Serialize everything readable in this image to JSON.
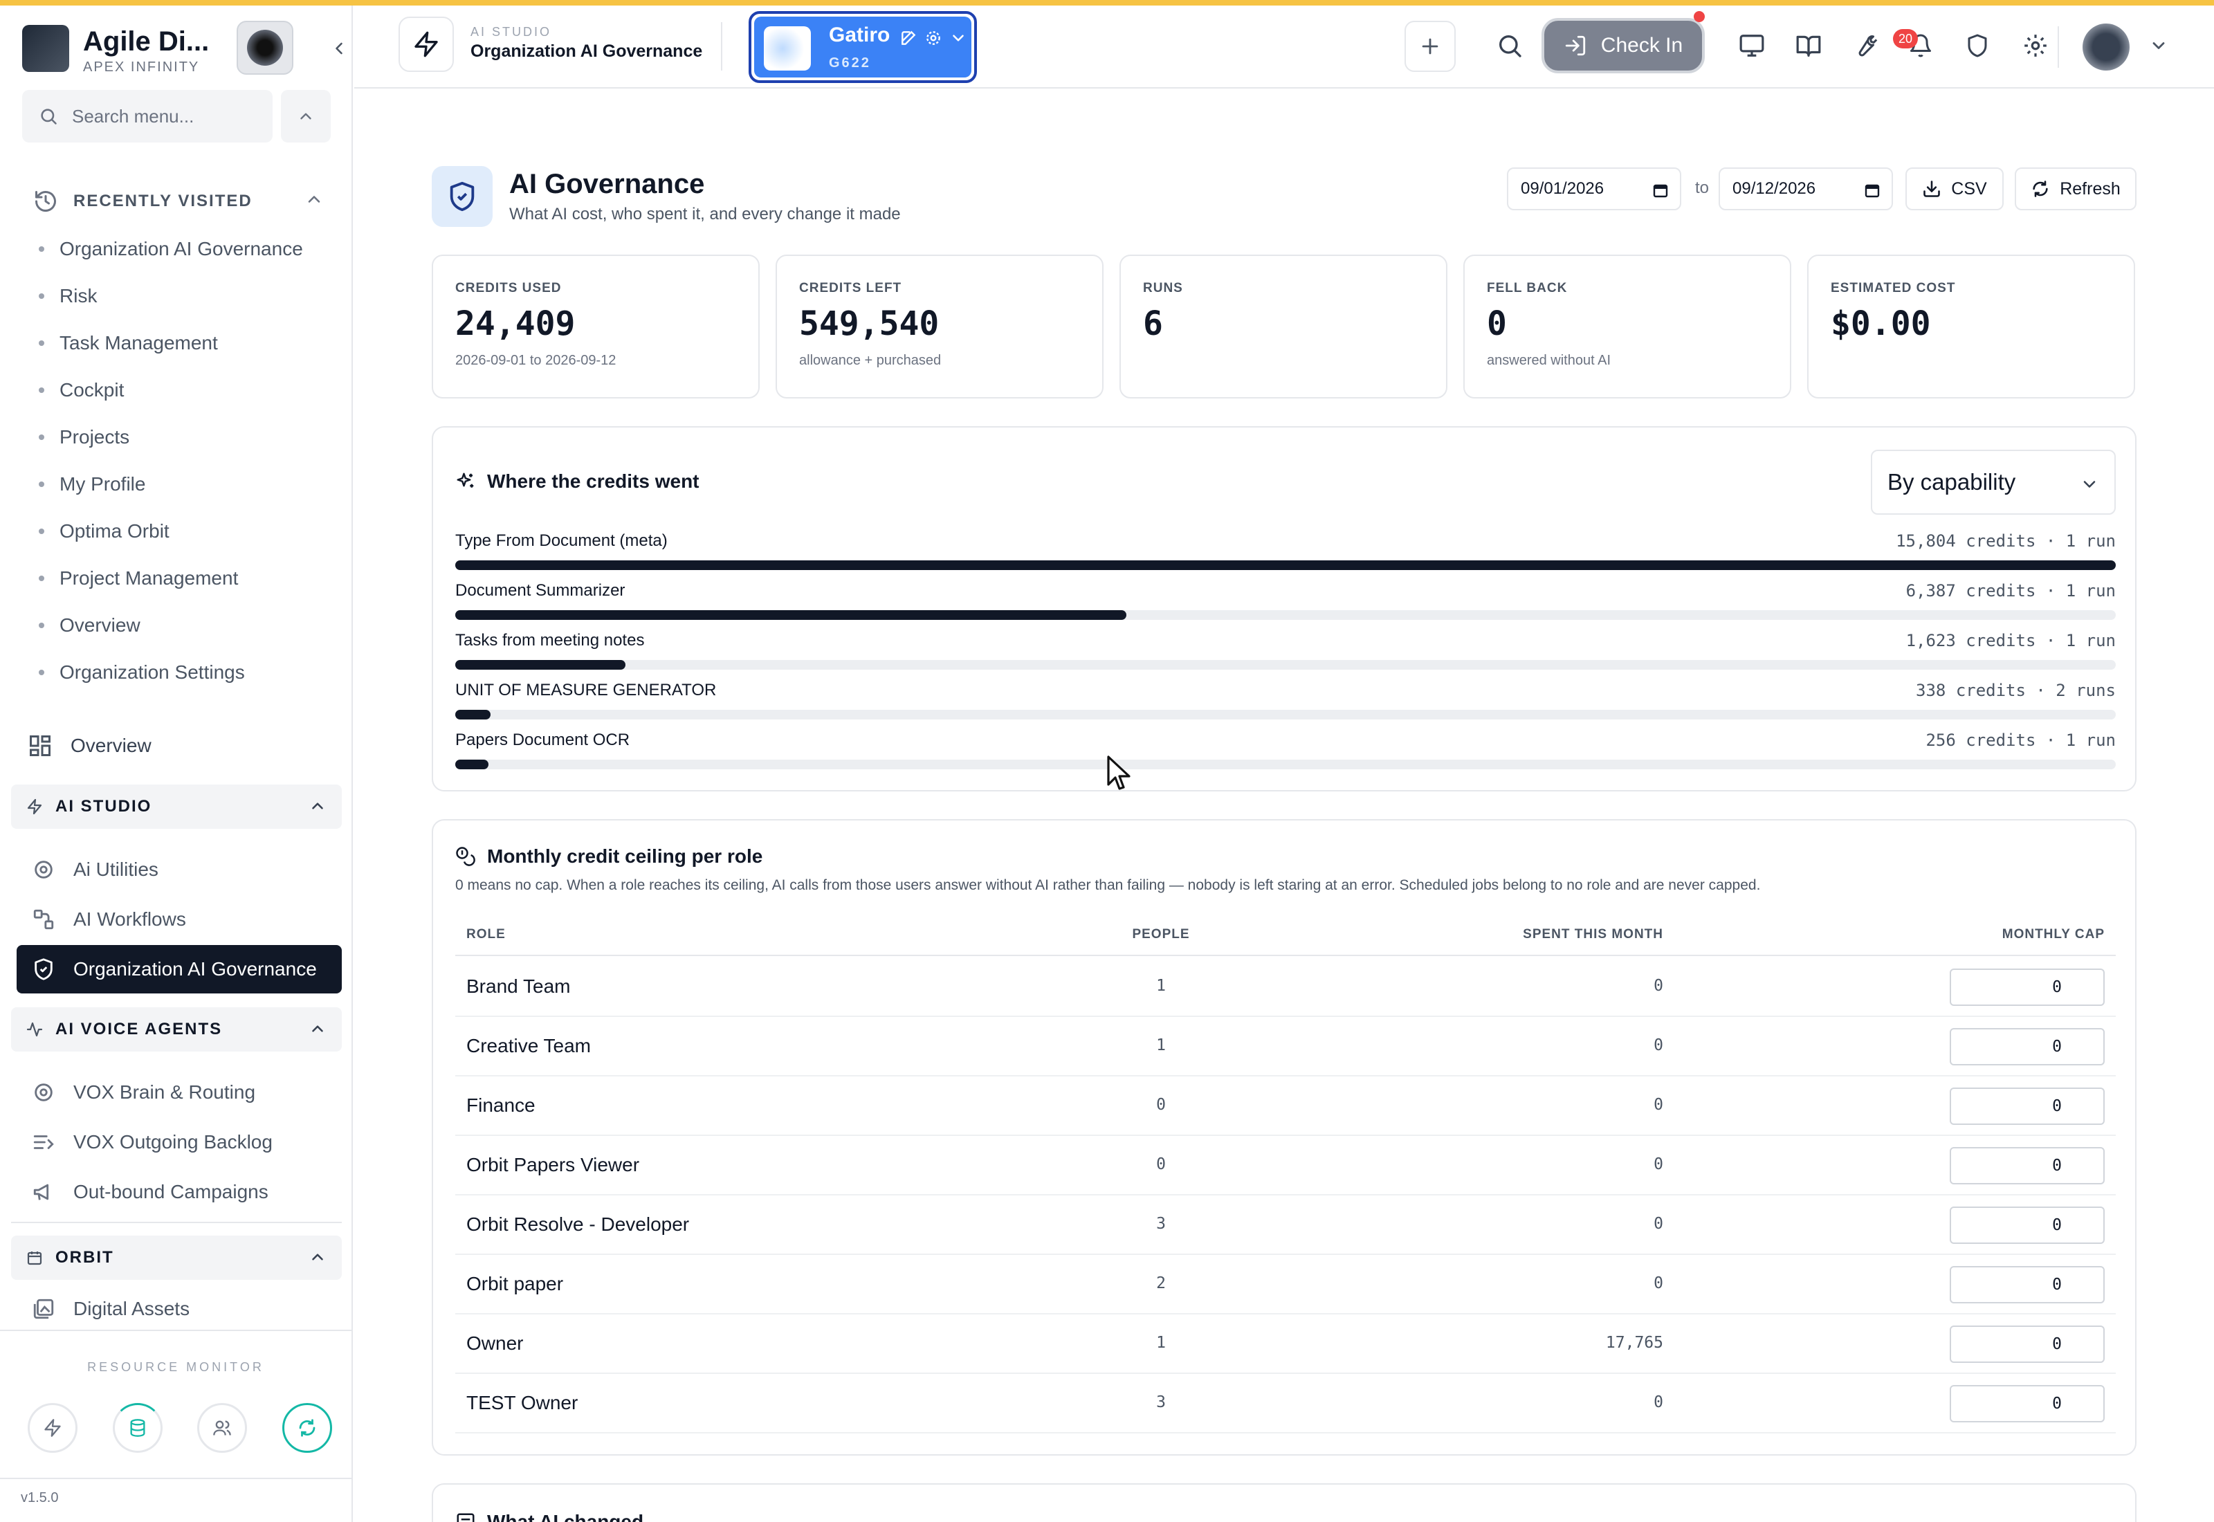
{
  "sidebar": {
    "brand_title": "Agile Di...",
    "brand_sub": "APEX INFINITY",
    "search_placeholder": "Search menu...",
    "recently_visited_label": "RECENTLY VISITED",
    "recent": [
      "Organization AI Governance",
      "Risk",
      "Task Management",
      "Cockpit",
      "Projects",
      "My Profile",
      "Optima Orbit",
      "Project Management",
      "Overview",
      "Organization Settings"
    ],
    "overview_label": "Overview",
    "groups": [
      {
        "label": "AI STUDIO",
        "items": [
          "Ai Utilities",
          "AI Workflows",
          "Organization AI Governance"
        ]
      },
      {
        "label": "AI VOICE AGENTS",
        "items": [
          "VOX Brain & Routing",
          "VOX Outgoing Backlog",
          "Out-bound Campaigns"
        ]
      },
      {
        "label": "ORBIT",
        "items": [
          "Digital Assets"
        ]
      }
    ],
    "active_item": "Organization AI Governance",
    "resource_monitor_label": "RESOURCE MONITOR",
    "version": "v1.5.0"
  },
  "header": {
    "kicker": "AI STUDIO",
    "title": "Organization AI Governance",
    "org_name": "Gatiro",
    "org_code": "G622",
    "checkin_label": "Check In",
    "notifications_count": "20"
  },
  "page": {
    "title": "AI Governance",
    "subtitle": "What AI cost, who spent it, and every change it made",
    "date_from": "09/01/2026",
    "to_label": "to",
    "date_to": "09/12/2026",
    "csv_label": "CSV",
    "refresh_label": "Refresh"
  },
  "stats": [
    {
      "label": "CREDITS USED",
      "value": "24,409",
      "sub": "2026-09-01 to 2026-09-12"
    },
    {
      "label": "CREDITS LEFT",
      "value": "549,540",
      "sub": "allowance + purchased"
    },
    {
      "label": "RUNS",
      "value": "6",
      "sub": ""
    },
    {
      "label": "FELL BACK",
      "value": "0",
      "sub": "answered without AI"
    },
    {
      "label": "ESTIMATED COST",
      "value": "$0.00",
      "sub": ""
    }
  ],
  "credits": {
    "title": "Where the credits went",
    "group_by": "By capability",
    "rows": [
      {
        "name": "Type From Document (meta)",
        "meta": "15,804 credits · 1 run",
        "credits": 15804
      },
      {
        "name": "Document Summarizer",
        "meta": "6,387 credits · 1 run",
        "credits": 6387
      },
      {
        "name": "Tasks from meeting notes",
        "meta": "1,623 credits · 1 run",
        "credits": 1623
      },
      {
        "name": "UNIT OF MEASURE GENERATOR",
        "meta": "338 credits · 2 runs",
        "credits": 338
      },
      {
        "name": "Papers Document OCR",
        "meta": "256 credits · 1 run",
        "credits": 256
      }
    ]
  },
  "ceiling": {
    "title": "Monthly credit ceiling per role",
    "note": "0 means no cap. When a role reaches its ceiling, AI calls from those users answer without AI rather than failing — nobody is left staring at an error. Scheduled jobs belong to no role and are never capped.",
    "columns": [
      "ROLE",
      "PEOPLE",
      "SPENT THIS MONTH",
      "MONTHLY CAP"
    ],
    "rows": [
      {
        "role": "Brand Team",
        "people": "1",
        "spent": "0",
        "cap": "0"
      },
      {
        "role": "Creative Team",
        "people": "1",
        "spent": "0",
        "cap": "0"
      },
      {
        "role": "Finance",
        "people": "0",
        "spent": "0",
        "cap": "0"
      },
      {
        "role": "Orbit Papers Viewer",
        "people": "0",
        "spent": "0",
        "cap": "0"
      },
      {
        "role": "Orbit Resolve - Developer",
        "people": "3",
        "spent": "0",
        "cap": "0"
      },
      {
        "role": "Orbit paper",
        "people": "2",
        "spent": "0",
        "cap": "0"
      },
      {
        "role": "Owner",
        "people": "1",
        "spent": "17,765",
        "cap": "0"
      },
      {
        "role": "TEST Owner",
        "people": "3",
        "spent": "0",
        "cap": "0"
      }
    ]
  },
  "changes": {
    "title": "What AI changed"
  },
  "icons": {
    "header": [
      "plus-icon",
      "search-icon",
      "monitor-icon",
      "book-icon",
      "wrench-icon",
      "bell-icon",
      "shield-icon",
      "gear-icon"
    ],
    "resource_monitor": [
      "bolt-icon",
      "database-icon",
      "users-icon",
      "refresh-icon"
    ]
  },
  "colors": {
    "accent": "#3b82f6",
    "active_nav": "#111827",
    "bar_fill": "#111827",
    "top_strip": "#f6c343",
    "badge": "#ef4444"
  }
}
